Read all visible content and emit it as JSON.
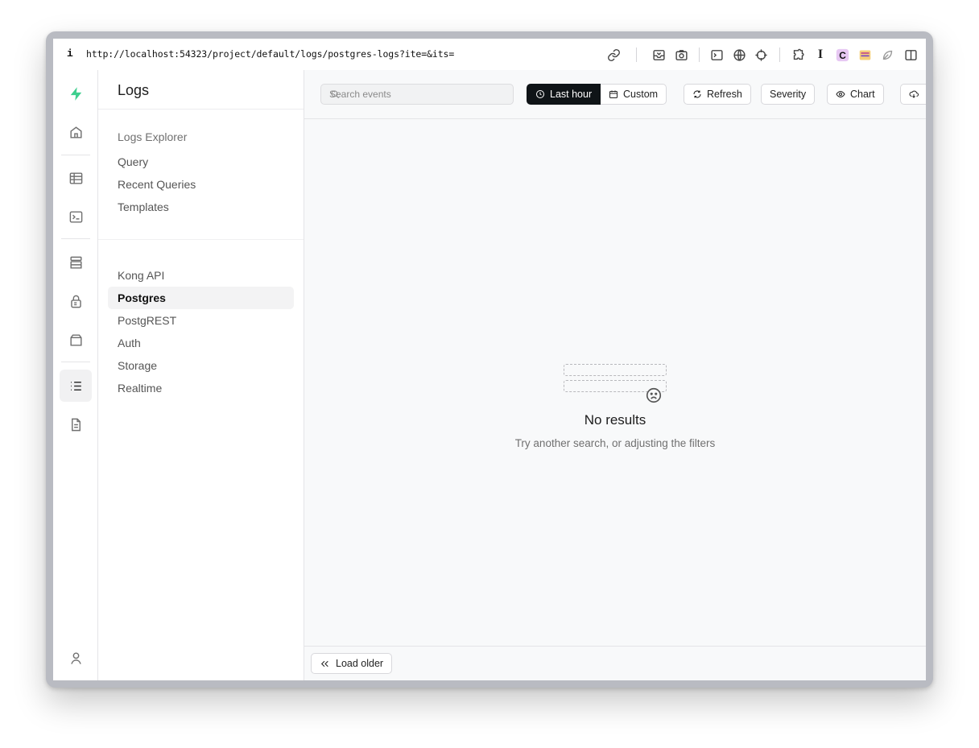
{
  "browser": {
    "info_label": "i",
    "url": "http://localhost:54323/project/default/logs/postgres-logs?ite=&its=",
    "extensions": [
      "link-icon",
      "inbox-icon",
      "camera-icon",
      "terminal-icon",
      "globe-icon",
      "crosshair-icon",
      "puzzle-icon",
      "text-cursor-icon",
      "c-extension-icon",
      "grid-extension-icon",
      "leaf-icon",
      "split-view-icon"
    ]
  },
  "rail": {
    "items": [
      "supabase-logo",
      "home-icon",
      "table-icon",
      "terminal-icon",
      "database-icon",
      "lock-icon",
      "storage-icon",
      "list-icon",
      "document-icon",
      "user-icon"
    ]
  },
  "sidemenu": {
    "title": "Logs",
    "explorer_heading": "Logs Explorer",
    "explorer_items": [
      "Query",
      "Recent Queries",
      "Templates"
    ],
    "sources": [
      "Kong API",
      "Postgres",
      "PostgREST",
      "Auth",
      "Storage",
      "Realtime"
    ],
    "active_source": "Postgres"
  },
  "toolbar": {
    "search_placeholder": "Search events",
    "last_hour": "Last hour",
    "custom": "Custom",
    "refresh": "Refresh",
    "severity": "Severity",
    "chart": "Chart"
  },
  "empty_state": {
    "title": "No results",
    "subtitle": "Try another search, or adjusting the filters"
  },
  "footer": {
    "load_older": "Load older"
  },
  "colors": {
    "brand": "#3ecf8e",
    "dark_button": "#0f1417",
    "main_bg": "#f8f9fa"
  }
}
